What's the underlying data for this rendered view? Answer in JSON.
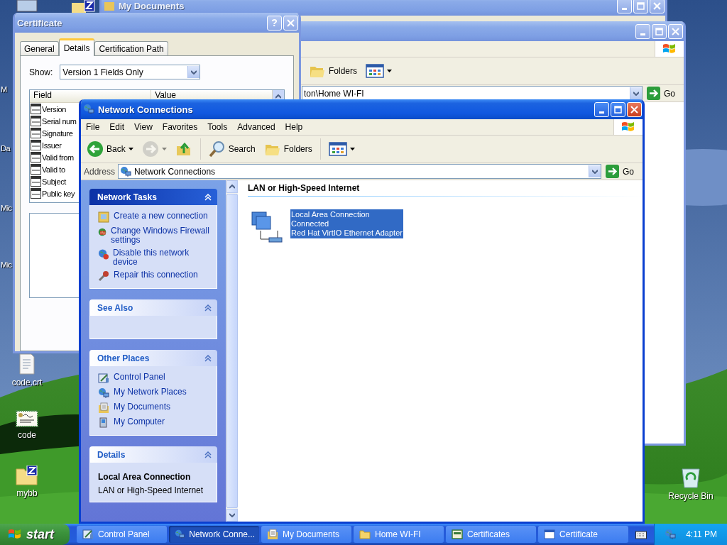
{
  "desktop": {
    "partial_labels": [
      "M",
      "Da",
      "Mic",
      "Mic"
    ],
    "icons": [
      {
        "label": "code.crt",
        "kind": "document"
      },
      {
        "label": "code",
        "kind": "certificate"
      },
      {
        "label": "mybb",
        "kind": "zip-folder"
      },
      {
        "label": "Recycle Bin",
        "kind": "recycle-bin"
      }
    ]
  },
  "my_documents": {
    "title": "My Documents"
  },
  "home_wifi": {
    "toolbar": [
      {
        "label": "Folders",
        "kind": "folders"
      },
      {
        "kind": "views"
      }
    ],
    "address": "ton\\Home WI-FI",
    "go": "Go"
  },
  "certificate": {
    "title": "Certificate",
    "help": "?",
    "tabs": [
      {
        "label": "General",
        "selected": false
      },
      {
        "label": "Details",
        "selected": true
      },
      {
        "label": "Certification Path",
        "selected": false
      }
    ],
    "show_label": "Show:",
    "show_value": "Version 1 Fields Only",
    "columns": [
      "Field",
      "Value"
    ],
    "fields": [
      "Version",
      "Serial num",
      "Signature",
      "Issuer",
      "Valid from",
      "Valid to",
      "Subject",
      "Public key"
    ]
  },
  "network_connections": {
    "title": "Network Connections",
    "menu": [
      "File",
      "Edit",
      "View",
      "Favorites",
      "Tools",
      "Advanced",
      "Help"
    ],
    "toolbar": [
      {
        "label": "Back",
        "kind": "back",
        "disabled": false
      },
      {
        "kind": "forward",
        "disabled": true
      },
      {
        "kind": "up",
        "disabled": false
      },
      {
        "label": "Search",
        "kind": "search",
        "disabled": false
      },
      {
        "label": "Folders",
        "kind": "folders",
        "disabled": false
      },
      {
        "kind": "views",
        "disabled": false
      }
    ],
    "address_label": "Address",
    "address": "Network Connections",
    "go": "Go",
    "panels": [
      {
        "title": "Network Tasks",
        "kind": "links",
        "items": [
          {
            "label": "Create a new connection",
            "kind": "new-connection"
          },
          {
            "label": "Change Windows Firewall settings",
            "kind": "firewall"
          },
          {
            "label": "Disable this network device",
            "kind": "disable"
          },
          {
            "label": "Repair this connection",
            "kind": "repair"
          }
        ]
      },
      {
        "title": "See Also",
        "kind": "links"
      },
      {
        "title": "Other Places",
        "kind": "links",
        "items": [
          {
            "label": "Control Panel",
            "kind": "control-panel"
          },
          {
            "label": "My Network Places",
            "kind": "network"
          },
          {
            "label": "My Documents",
            "kind": "documents"
          },
          {
            "label": "My Computer",
            "kind": "computer"
          }
        ]
      },
      {
        "title": "Details",
        "kind": "details",
        "heading": "Local Area Connection",
        "text": "LAN or High-Speed Internet"
      }
    ],
    "group": {
      "heading": "LAN or High-Speed Internet",
      "items": [
        {
          "lines": [
            "Local Area Connection",
            "Connected",
            "Red Hat VirtIO Ethernet Adapter"
          ],
          "selected": true
        }
      ]
    }
  },
  "taskbar": {
    "start": "start",
    "items": [
      {
        "label": "Control Panel",
        "kind": "control-panel",
        "selected": false
      },
      {
        "label": "Network Conne...",
        "kind": "network",
        "selected": true
      },
      {
        "label": "My Documents",
        "kind": "documents",
        "selected": false
      },
      {
        "label": "Home WI-FI",
        "kind": "folder",
        "selected": false
      },
      {
        "label": "Certificates",
        "kind": "certificates",
        "selected": false
      },
      {
        "label": "Certificate",
        "kind": "window",
        "selected": false
      }
    ],
    "time": "4:11 PM"
  }
}
